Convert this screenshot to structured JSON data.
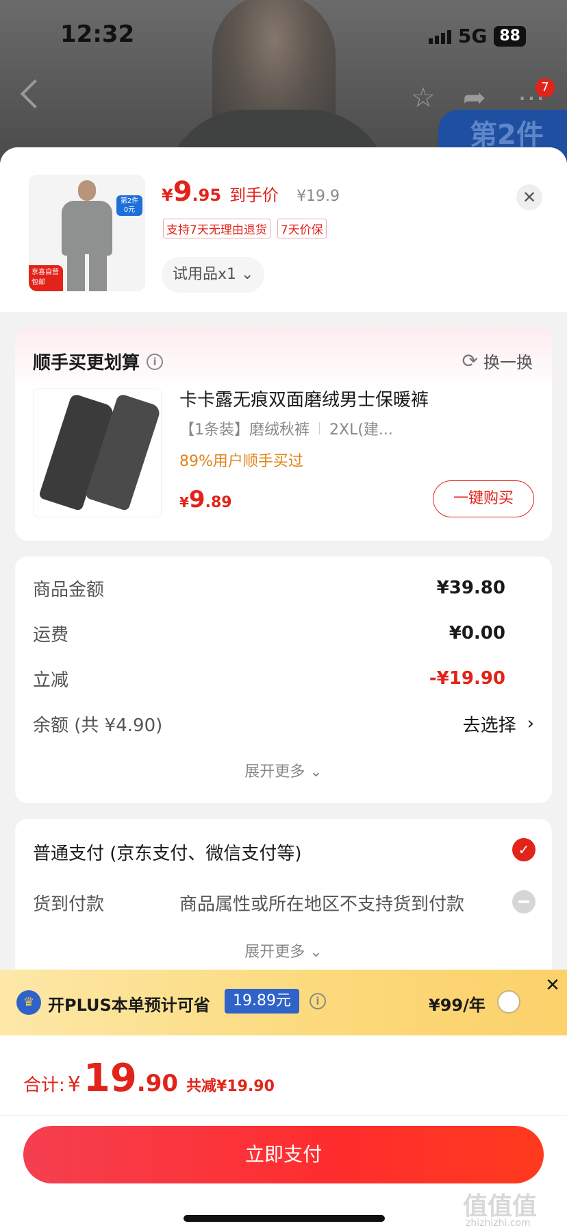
{
  "status_bar": {
    "time": "12:32",
    "network": "5G",
    "battery": "88"
  },
  "backdrop": {
    "promo_tag": "第2件",
    "nav_badge": "7"
  },
  "product": {
    "price_yen": "¥",
    "price_int": "9",
    "price_dec": ".95",
    "price_label": "到手价",
    "original_price": "¥19.9",
    "tags": [
      "支持7天无理由退货",
      "7天价保"
    ],
    "spec_label": "试用品x1",
    "thumb_badge": "第2件\n0元",
    "thumb_ship": "京喜自营\n包邮"
  },
  "recommend": {
    "title": "顺手买更划算",
    "swap_label": "换一换",
    "name": "卡卡露无痕双面磨绒男士保暖裤",
    "spec_a": "【1条装】磨绒秋裤",
    "spec_b": "2XL(建...",
    "rate": "89%用户顺手买过",
    "price_yen": "¥",
    "price_int": "9",
    "price_dec": ".89",
    "buy_label": "一键购买"
  },
  "summary": {
    "goods_label": "商品金额",
    "goods_value": "¥39.80",
    "shipping_label": "运费",
    "shipping_value": "¥0.00",
    "discount_label": "立减",
    "discount_value": "-¥19.90",
    "balance_label": "余额 (共 ¥4.90)",
    "balance_action": "去选择",
    "expand_label": "展开更多"
  },
  "payment": {
    "normal_label": "普通支付 (京东支付、微信支付等)",
    "cod_label": "货到付款",
    "cod_note": "商品属性或所在地区不支持货到付款",
    "expand_label": "展开更多"
  },
  "plus": {
    "text": "开PLUS本单预计可省",
    "save": "19.89元",
    "price": "¥99/年"
  },
  "footer": {
    "total_label": "合计:",
    "total_yen": "¥",
    "total_int": "19",
    "total_dec": ".90",
    "total_saved": "共减¥19.90",
    "pay_label": "立即支付"
  },
  "watermark": {
    "main": "值值值",
    "sub": "zhizhizhi.com"
  },
  "colors": {
    "accent": "#e2231a",
    "plus_blue": "#2f63c9",
    "orange": "#e0841a"
  }
}
